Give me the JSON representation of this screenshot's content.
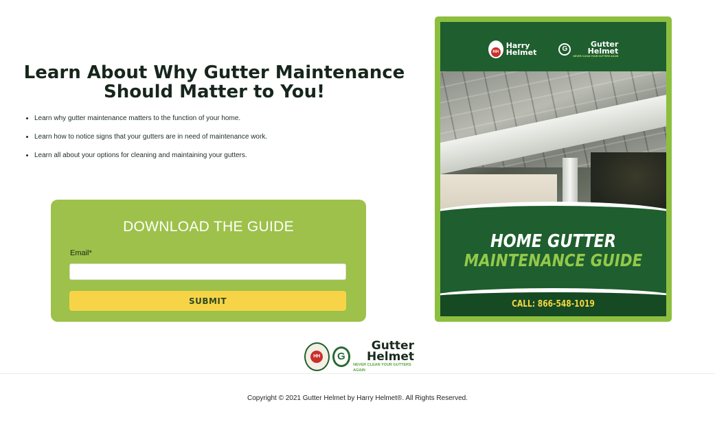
{
  "hero": {
    "headline": "Learn About Why Gutter Maintenance Should Matter to You!",
    "bullets": [
      "Learn why gutter maintenance matters to the function of your home.",
      "Learn how to notice signs that your gutters are in need of maintenance work.",
      "Learn all about your options for cleaning and maintaining your gutters."
    ]
  },
  "form": {
    "title": "DOWNLOAD THE GUIDE",
    "email_label": "Email*",
    "email_value": "",
    "email_placeholder": "",
    "submit_label": "SUBMIT"
  },
  "guide_cover": {
    "harry_helmet_line1": "Harry",
    "harry_helmet_line2": "Helmet",
    "harry_helmet_badge": "HH",
    "gutter_helmet_line1": "Gutter",
    "gutter_helmet_line2": "Helmet",
    "gutter_helmet_mark": "G",
    "gutter_helmet_tagline": "NEVER CLEAN YOUR GUTTERS AGAIN",
    "title_line1": "HOME GUTTER",
    "title_line2": "MAINTENANCE GUIDE",
    "call": "CALL: 866-548-1019",
    "photo_icon": "gutter-guard-roof-photo"
  },
  "footer": {
    "logo_harry_badge": "HH",
    "logo_gutter_mark": "G",
    "logo_line1": "Gutter",
    "logo_line2": "Helmet",
    "logo_tagline": "NEVER CLEAN YOUR GUTTERS AGAIN",
    "copyright": "Copyright © 2021 Gutter Helmet by Harry Helmet®. All Rights Reserved."
  },
  "colors": {
    "form_green": "#9dc14a",
    "submit_yellow": "#f7d447",
    "cover_dark_green": "#1f5e2e",
    "cover_light_green": "#93c94b",
    "call_yellow": "#f5d642"
  }
}
